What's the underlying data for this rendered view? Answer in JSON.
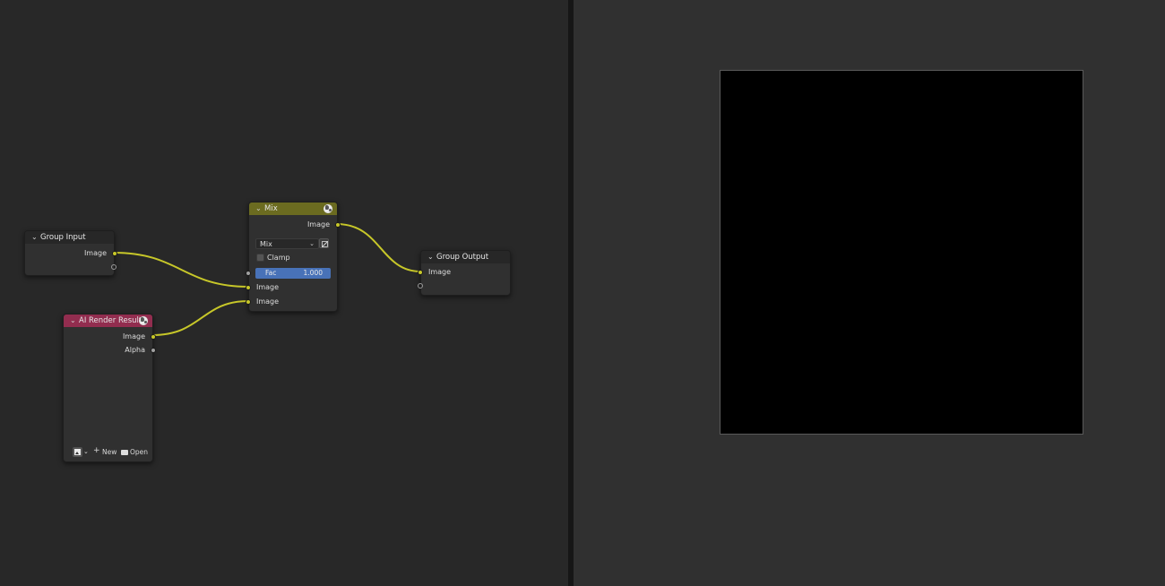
{
  "nodes": {
    "group_input": {
      "title": "Group Input",
      "outputs": [
        "Image"
      ]
    },
    "ai_render": {
      "title": "AI Render Result",
      "outputs": [
        "Image",
        "Alpha"
      ],
      "buttons": {
        "new_label": "New",
        "open_label": "Open"
      }
    },
    "mix": {
      "title": "Mix",
      "output_label": "Image",
      "blend_mode": "Mix",
      "clamp_label": "Clamp",
      "clamp_checked": false,
      "fac_label": "Fac",
      "fac_value": "1.000",
      "inputs": [
        "Image",
        "Image"
      ]
    },
    "group_output": {
      "title": "Group Output",
      "inputs": [
        "Image"
      ]
    }
  },
  "colors": {
    "node_editor_bg": "#282828",
    "image_editor_bg": "#303030",
    "node_body": "#303030",
    "header_input": "#272727",
    "header_mix": "#6b6b20",
    "header_texture": "#922d4f",
    "header_output": "#272727",
    "link": "#c7c729",
    "fac_field": "#4872b8"
  },
  "icons": {
    "collapse": "chevron-down-icon",
    "node_group": "globe-icon",
    "image_browse": "image-icon",
    "new": "plus-icon",
    "open": "folder-icon",
    "invert": "invert-icon"
  },
  "viewer": {
    "image_color": "#000000"
  }
}
